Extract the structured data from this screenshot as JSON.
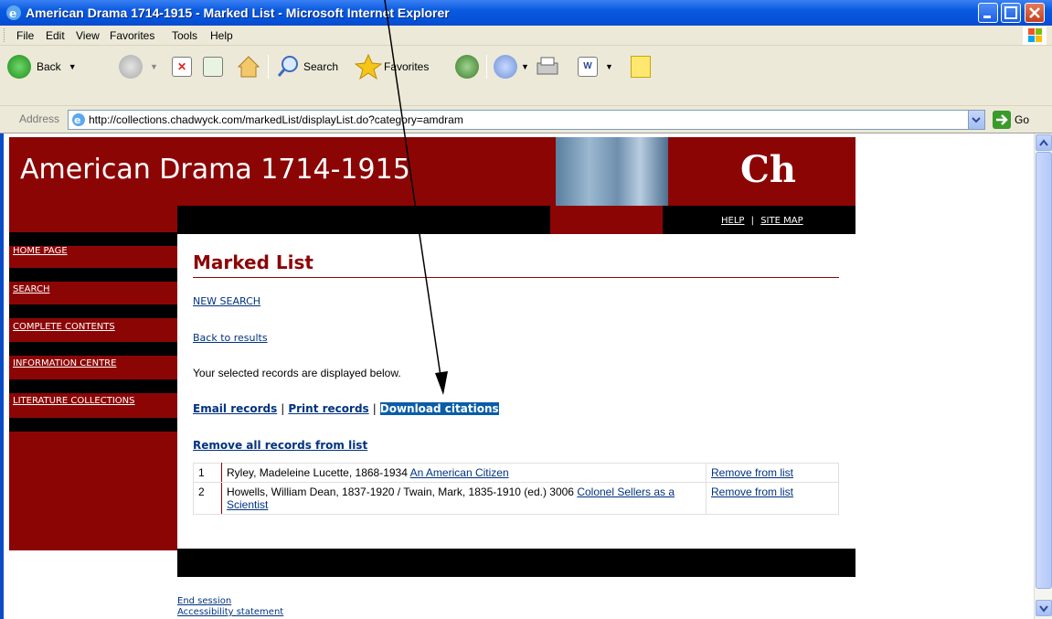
{
  "window": {
    "title": "American Drama 1714-1915 - Marked List - Microsoft Internet Explorer"
  },
  "menubar": {
    "items": [
      "File",
      "Edit",
      "View",
      "Favorites",
      "Tools",
      "Help"
    ]
  },
  "toolbar": {
    "back_label": "Back",
    "search_label": "Search",
    "favorites_label": "Favorites"
  },
  "addressbar": {
    "label": "Address",
    "url": "http://collections.chadwyck.com/markedList/displayList.do?category=amdram",
    "go_label": "Go"
  },
  "site": {
    "title": "American Drama 1714-1915",
    "logo_text": "Ch",
    "util_links": [
      "HELP",
      "SITE MAP"
    ],
    "util_sep": "|"
  },
  "sidebar": {
    "items": [
      "HOME PAGE",
      "SEARCH",
      "COMPLETE CONTENTS",
      "INFORMATION CENTRE",
      "LITERATURE COLLECTIONS"
    ]
  },
  "main": {
    "page_title": "Marked List",
    "new_search": "NEW SEARCH",
    "back_to_results": "Back to results",
    "intro_text": "Your selected records are displayed below.",
    "actions": {
      "email": "Email records",
      "print": "Print records",
      "download": "Download citations",
      "sep": "|"
    },
    "remove_all": "Remove all records from list"
  },
  "records": [
    {
      "num": "1",
      "author": "Ryley, Madeleine Lucette, 1868-1934",
      "title_link": "An American Citizen",
      "remove": "Remove from list"
    },
    {
      "num": "2",
      "author": "Howells, William Dean, 1837-1920 / Twain, Mark, 1835-1910 (ed.) 3006",
      "title_link": "Colonel Sellers as a Scientist",
      "remove": "Remove from list"
    }
  ],
  "footer": {
    "end_session": "End session",
    "accessibility": "Accessibility statement"
  }
}
